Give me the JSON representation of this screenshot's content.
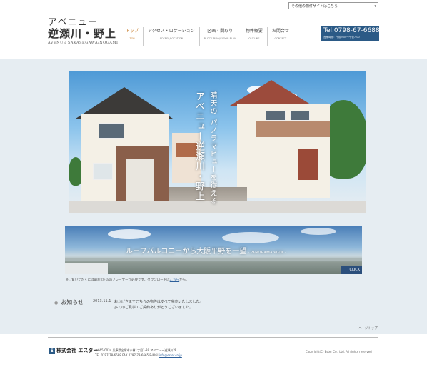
{
  "header": {
    "site_select": "その他の物件サイトはこちら",
    "logo_line1": "アベニュー",
    "logo_line2": "逆瀬川・野上",
    "logo_sub": "AVENUE SAKASEGAWA/NOGAMI",
    "nav": [
      {
        "jp": "トップ",
        "en": "TOP"
      },
      {
        "jp": "アクセス・ロケーション",
        "en": "ACCESS/LOCATION"
      },
      {
        "jp": "区画・間取り",
        "en": "BLOCK PLAN/FLOOR PLAN"
      },
      {
        "jp": "物件概要",
        "en": "OUTLINE"
      },
      {
        "jp": "お問合せ",
        "en": "CONTACT"
      }
    ],
    "tel_number": "Tel.0798-67-6688",
    "tel_hours": "営業時間：午前9:00〜午後7:00"
  },
  "hero": {
    "catch_line1": "晴天の",
    "catch_line2": "パノラマビューを従える",
    "catch_line3": "アベニュー逆瀬川・野上"
  },
  "panorama": {
    "text": "ルーフバルコニーから大阪平野を一望",
    "text_en": "- PANORAMA VIEW -",
    "click_label": "CLICK"
  },
  "flash_note": {
    "text": "※ご覧いただくには最新のFlashプレーヤーが必要です。ダウンロードは",
    "link": "こちら",
    "suffix": "から。"
  },
  "news": {
    "title": "お知らせ",
    "date": "2013.11.1",
    "line1": "おかげさまでこちらの物件はすべて完売いたしました。",
    "line2": "多くのご見学・ご契約ありがとうございました。"
  },
  "footer": {
    "pagetop": "ページトップ",
    "company": "株式会社 エスター",
    "address": "〒665-0034 兵庫県宝塚市小林1丁目1-39 アベニュー逆瀬川2F",
    "contact_prefix": "TEL.0797-78-6688 FAX.0797-78-6665 E-Mail.",
    "email": "info@ester.co.jp",
    "copyright": "Copyright(C) Ester Co., Ltd.  All rights reserved"
  },
  "colors": {
    "accent_blue": "#2b5a86",
    "nav_active": "#c77c2a",
    "band_bg": "#e6edf2"
  }
}
